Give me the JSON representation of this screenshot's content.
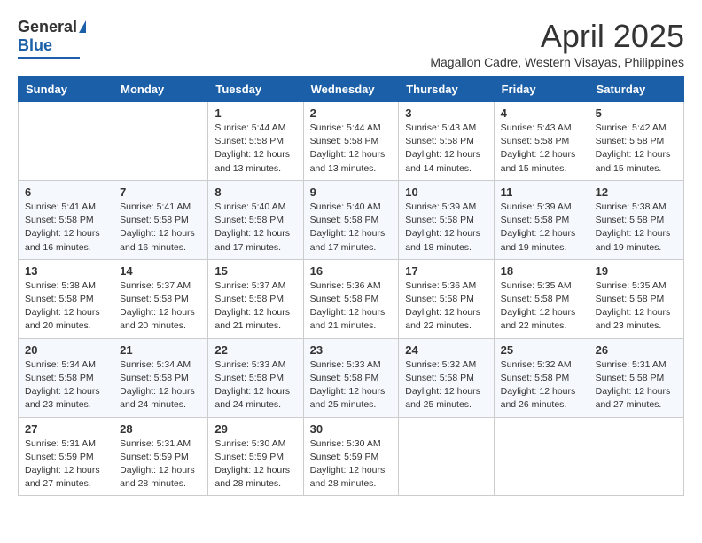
{
  "logo": {
    "general": "General",
    "blue": "Blue"
  },
  "title": "April 2025",
  "location": "Magallon Cadre, Western Visayas, Philippines",
  "days_header": [
    "Sunday",
    "Monday",
    "Tuesday",
    "Wednesday",
    "Thursday",
    "Friday",
    "Saturday"
  ],
  "weeks": [
    [
      {
        "day": "",
        "info": ""
      },
      {
        "day": "",
        "info": ""
      },
      {
        "day": "1",
        "info": "Sunrise: 5:44 AM\nSunset: 5:58 PM\nDaylight: 12 hours and 13 minutes."
      },
      {
        "day": "2",
        "info": "Sunrise: 5:44 AM\nSunset: 5:58 PM\nDaylight: 12 hours and 13 minutes."
      },
      {
        "day": "3",
        "info": "Sunrise: 5:43 AM\nSunset: 5:58 PM\nDaylight: 12 hours and 14 minutes."
      },
      {
        "day": "4",
        "info": "Sunrise: 5:43 AM\nSunset: 5:58 PM\nDaylight: 12 hours and 15 minutes."
      },
      {
        "day": "5",
        "info": "Sunrise: 5:42 AM\nSunset: 5:58 PM\nDaylight: 12 hours and 15 minutes."
      }
    ],
    [
      {
        "day": "6",
        "info": "Sunrise: 5:41 AM\nSunset: 5:58 PM\nDaylight: 12 hours and 16 minutes."
      },
      {
        "day": "7",
        "info": "Sunrise: 5:41 AM\nSunset: 5:58 PM\nDaylight: 12 hours and 16 minutes."
      },
      {
        "day": "8",
        "info": "Sunrise: 5:40 AM\nSunset: 5:58 PM\nDaylight: 12 hours and 17 minutes."
      },
      {
        "day": "9",
        "info": "Sunrise: 5:40 AM\nSunset: 5:58 PM\nDaylight: 12 hours and 17 minutes."
      },
      {
        "day": "10",
        "info": "Sunrise: 5:39 AM\nSunset: 5:58 PM\nDaylight: 12 hours and 18 minutes."
      },
      {
        "day": "11",
        "info": "Sunrise: 5:39 AM\nSunset: 5:58 PM\nDaylight: 12 hours and 19 minutes."
      },
      {
        "day": "12",
        "info": "Sunrise: 5:38 AM\nSunset: 5:58 PM\nDaylight: 12 hours and 19 minutes."
      }
    ],
    [
      {
        "day": "13",
        "info": "Sunrise: 5:38 AM\nSunset: 5:58 PM\nDaylight: 12 hours and 20 minutes."
      },
      {
        "day": "14",
        "info": "Sunrise: 5:37 AM\nSunset: 5:58 PM\nDaylight: 12 hours and 20 minutes."
      },
      {
        "day": "15",
        "info": "Sunrise: 5:37 AM\nSunset: 5:58 PM\nDaylight: 12 hours and 21 minutes."
      },
      {
        "day": "16",
        "info": "Sunrise: 5:36 AM\nSunset: 5:58 PM\nDaylight: 12 hours and 21 minutes."
      },
      {
        "day": "17",
        "info": "Sunrise: 5:36 AM\nSunset: 5:58 PM\nDaylight: 12 hours and 22 minutes."
      },
      {
        "day": "18",
        "info": "Sunrise: 5:35 AM\nSunset: 5:58 PM\nDaylight: 12 hours and 22 minutes."
      },
      {
        "day": "19",
        "info": "Sunrise: 5:35 AM\nSunset: 5:58 PM\nDaylight: 12 hours and 23 minutes."
      }
    ],
    [
      {
        "day": "20",
        "info": "Sunrise: 5:34 AM\nSunset: 5:58 PM\nDaylight: 12 hours and 23 minutes."
      },
      {
        "day": "21",
        "info": "Sunrise: 5:34 AM\nSunset: 5:58 PM\nDaylight: 12 hours and 24 minutes."
      },
      {
        "day": "22",
        "info": "Sunrise: 5:33 AM\nSunset: 5:58 PM\nDaylight: 12 hours and 24 minutes."
      },
      {
        "day": "23",
        "info": "Sunrise: 5:33 AM\nSunset: 5:58 PM\nDaylight: 12 hours and 25 minutes."
      },
      {
        "day": "24",
        "info": "Sunrise: 5:32 AM\nSunset: 5:58 PM\nDaylight: 12 hours and 25 minutes."
      },
      {
        "day": "25",
        "info": "Sunrise: 5:32 AM\nSunset: 5:58 PM\nDaylight: 12 hours and 26 minutes."
      },
      {
        "day": "26",
        "info": "Sunrise: 5:31 AM\nSunset: 5:58 PM\nDaylight: 12 hours and 27 minutes."
      }
    ],
    [
      {
        "day": "27",
        "info": "Sunrise: 5:31 AM\nSunset: 5:59 PM\nDaylight: 12 hours and 27 minutes."
      },
      {
        "day": "28",
        "info": "Sunrise: 5:31 AM\nSunset: 5:59 PM\nDaylight: 12 hours and 28 minutes."
      },
      {
        "day": "29",
        "info": "Sunrise: 5:30 AM\nSunset: 5:59 PM\nDaylight: 12 hours and 28 minutes."
      },
      {
        "day": "30",
        "info": "Sunrise: 5:30 AM\nSunset: 5:59 PM\nDaylight: 12 hours and 28 minutes."
      },
      {
        "day": "",
        "info": ""
      },
      {
        "day": "",
        "info": ""
      },
      {
        "day": "",
        "info": ""
      }
    ]
  ]
}
